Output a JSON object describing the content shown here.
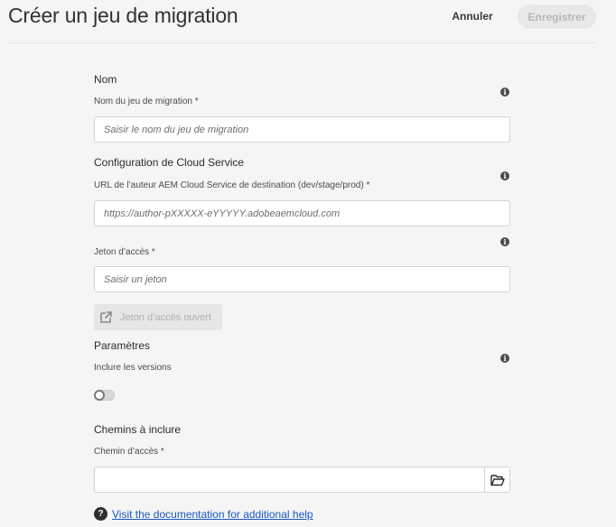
{
  "header": {
    "title": "Créer un jeu de migration",
    "cancel_label": "Annuler",
    "save_label": "Enregistrer"
  },
  "name_section": {
    "title": "Nom",
    "field_label": "Nom du jeu de migration *",
    "placeholder": "Saisir le nom du jeu de migration",
    "info_icon": "info-icon"
  },
  "cloud_section": {
    "title": "Configuration de Cloud Service",
    "url_label": "URL de l’auteur AEM Cloud Service de destination (dev/stage/prod) *",
    "url_placeholder": "https://author-pXXXXX-eYYYYY.adobeaemcloud.com",
    "token_label": "Jeton d’accès *",
    "token_placeholder": "Saisir un jeton",
    "open_token_label": "Jeton d’accès ouvert",
    "open_token_icon": "external-link-icon"
  },
  "params_section": {
    "title": "Paramètres",
    "include_versions_label": "Inclure les versions",
    "include_versions_on": false
  },
  "paths_section": {
    "title": "Chemins à inclure",
    "path_label": "Chemin d’accès *",
    "path_value": "",
    "browse_icon": "folder-open-icon"
  },
  "help": {
    "icon": "help-icon",
    "link_text": "Visit the documentation for additional help"
  },
  "colors": {
    "background": "#f5f5f5",
    "link": "#1957c2",
    "disabled_button": "#e8e8e8"
  }
}
